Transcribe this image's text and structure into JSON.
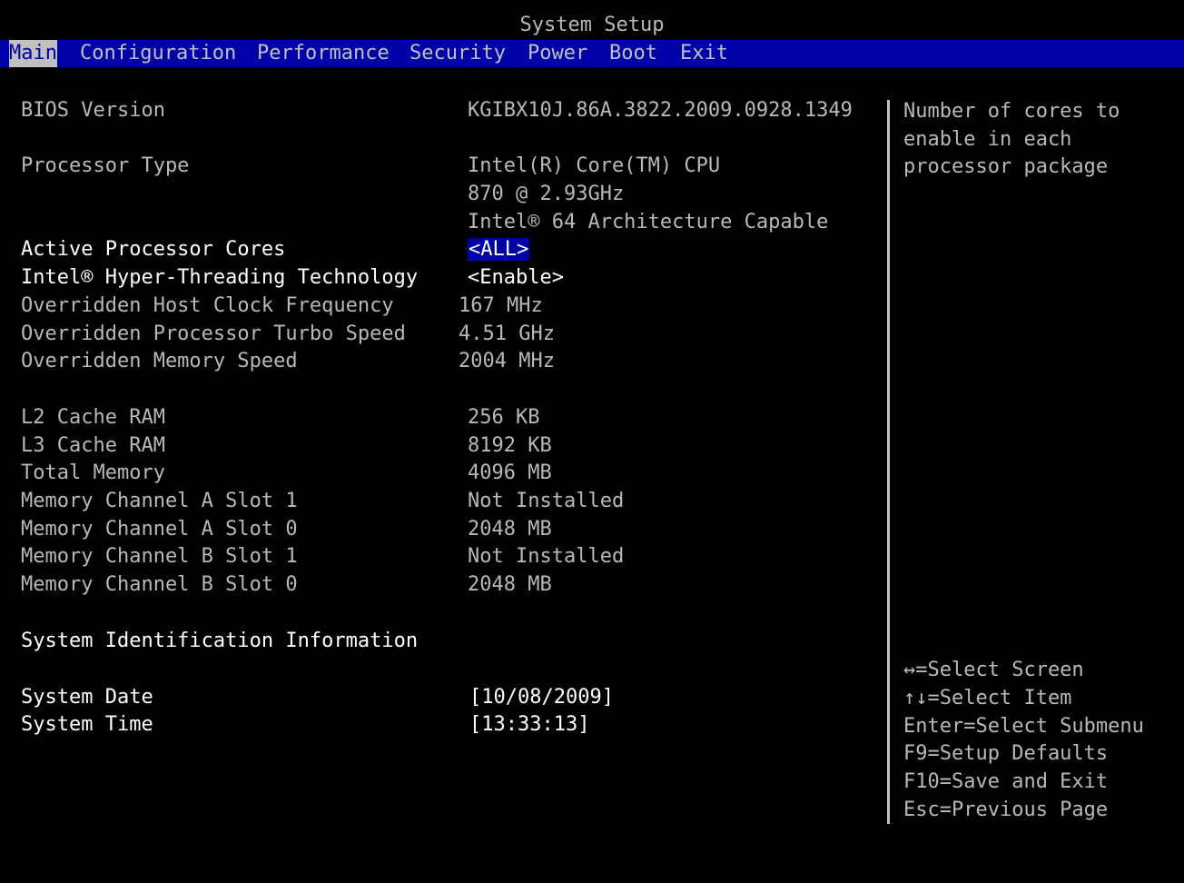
{
  "title": "System Setup",
  "menu": {
    "items": [
      {
        "label": "Main",
        "active": true
      },
      {
        "label": "Configuration",
        "active": false
      },
      {
        "label": "Performance",
        "active": false
      },
      {
        "label": "Security",
        "active": false
      },
      {
        "label": "Power",
        "active": false
      },
      {
        "label": "Boot",
        "active": false
      },
      {
        "label": "Exit",
        "active": false
      }
    ]
  },
  "main": {
    "bios_version": {
      "label": "BIOS Version",
      "value": "KGIBX10J.86A.3822.2009.0928.1349"
    },
    "processor_type": {
      "label": "Processor Type",
      "value_lines": [
        "Intel(R) Core(TM) CPU",
        "870  @ 2.93GHz",
        "Intel® 64 Architecture Capable"
      ]
    },
    "active_cores": {
      "label": "Active Processor Cores",
      "value": "<ALL>"
    },
    "hyper_threading": {
      "label": "Intel® Hyper-Threading Technology",
      "value": "<Enable>"
    },
    "host_clock": {
      "label": "Overridden Host Clock Frequency",
      "value": "167 MHz"
    },
    "turbo_speed": {
      "label": "Overridden Processor Turbo Speed",
      "value": "4.51 GHz"
    },
    "memory_speed": {
      "label": "Overridden Memory Speed",
      "value": "2004 MHz"
    },
    "l2_cache": {
      "label": "L2 Cache RAM",
      "value": "256 KB"
    },
    "l3_cache": {
      "label": "L3 Cache RAM",
      "value": "8192 KB"
    },
    "total_memory": {
      "label": "Total Memory",
      "value": "4096 MB"
    },
    "mem_a1": {
      "label": "Memory Channel A Slot 1",
      "value": "Not Installed"
    },
    "mem_a0": {
      "label": "Memory Channel A Slot 0",
      "value": "2048 MB"
    },
    "mem_b1": {
      "label": "Memory Channel B Slot 1",
      "value": "Not Installed"
    },
    "mem_b0": {
      "label": "Memory Channel B Slot 0",
      "value": "2048 MB"
    },
    "sys_id_info": {
      "label": "System Identification Information"
    },
    "system_date": {
      "label": "System Date",
      "value": "[10/08/2009]"
    },
    "system_time": {
      "label": "System Time",
      "value": "[13:33:13]"
    }
  },
  "help": {
    "description_lines": [
      "Number of cores to",
      "enable in each",
      "processor package"
    ],
    "keys": [
      "↔=Select Screen",
      "↑↓=Select Item",
      "Enter=Select Submenu",
      "F9=Setup Defaults",
      "F10=Save and Exit",
      "Esc=Previous Page"
    ]
  },
  "colors": {
    "background": "#000000",
    "menu_bar": "#0000a8",
    "highlight": "#0000a8",
    "text_dim": "#b8b8b8",
    "text_bright": "#ffffff"
  }
}
